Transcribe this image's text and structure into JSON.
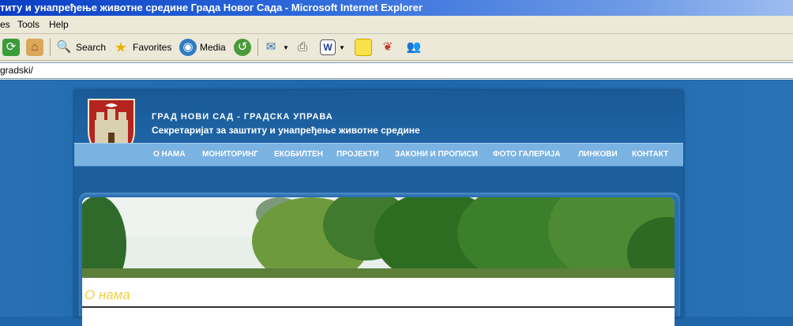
{
  "window": {
    "title": "титу и унапређење животне средине Града Новог Сада - Microsoft Internet Explorer"
  },
  "menu": {
    "items": [
      "es",
      "Tools",
      "Help"
    ]
  },
  "toolbar": {
    "search_label": "Search",
    "favorites_label": "Favorites",
    "media_label": "Media",
    "icons": [
      "refresh-icon",
      "home-icon",
      "search-icon",
      "favorites-icon",
      "media-icon",
      "history-icon",
      "mail-icon",
      "print-icon",
      "word-icon",
      "note-icon",
      "messenger-icon",
      "contacts-icon"
    ]
  },
  "address": {
    "value": "gradski/"
  },
  "site": {
    "org": "ГРАД НОВИ САД - ГРАДСКА УПРАВА",
    "secretariat": "Секретаријат за заштиту и унапређење животне средине",
    "nav": [
      "О НАМА",
      "МОНИТОРИНГ",
      "ЕКОБИЛТЕН",
      "ПРОЈЕКТИ",
      "ЗАКОНИ И ПРОПИСИ",
      "ФОТО ГАЛЕРИЈА",
      "ЛИНКОВИ",
      "КОНТАКТ"
    ],
    "page_heading": "О нама"
  },
  "colors": {
    "titlebar": "#0a3ec4",
    "nav": "#7ab3e2",
    "page_bg": "#1f66a8",
    "heading": "#f0d040"
  }
}
